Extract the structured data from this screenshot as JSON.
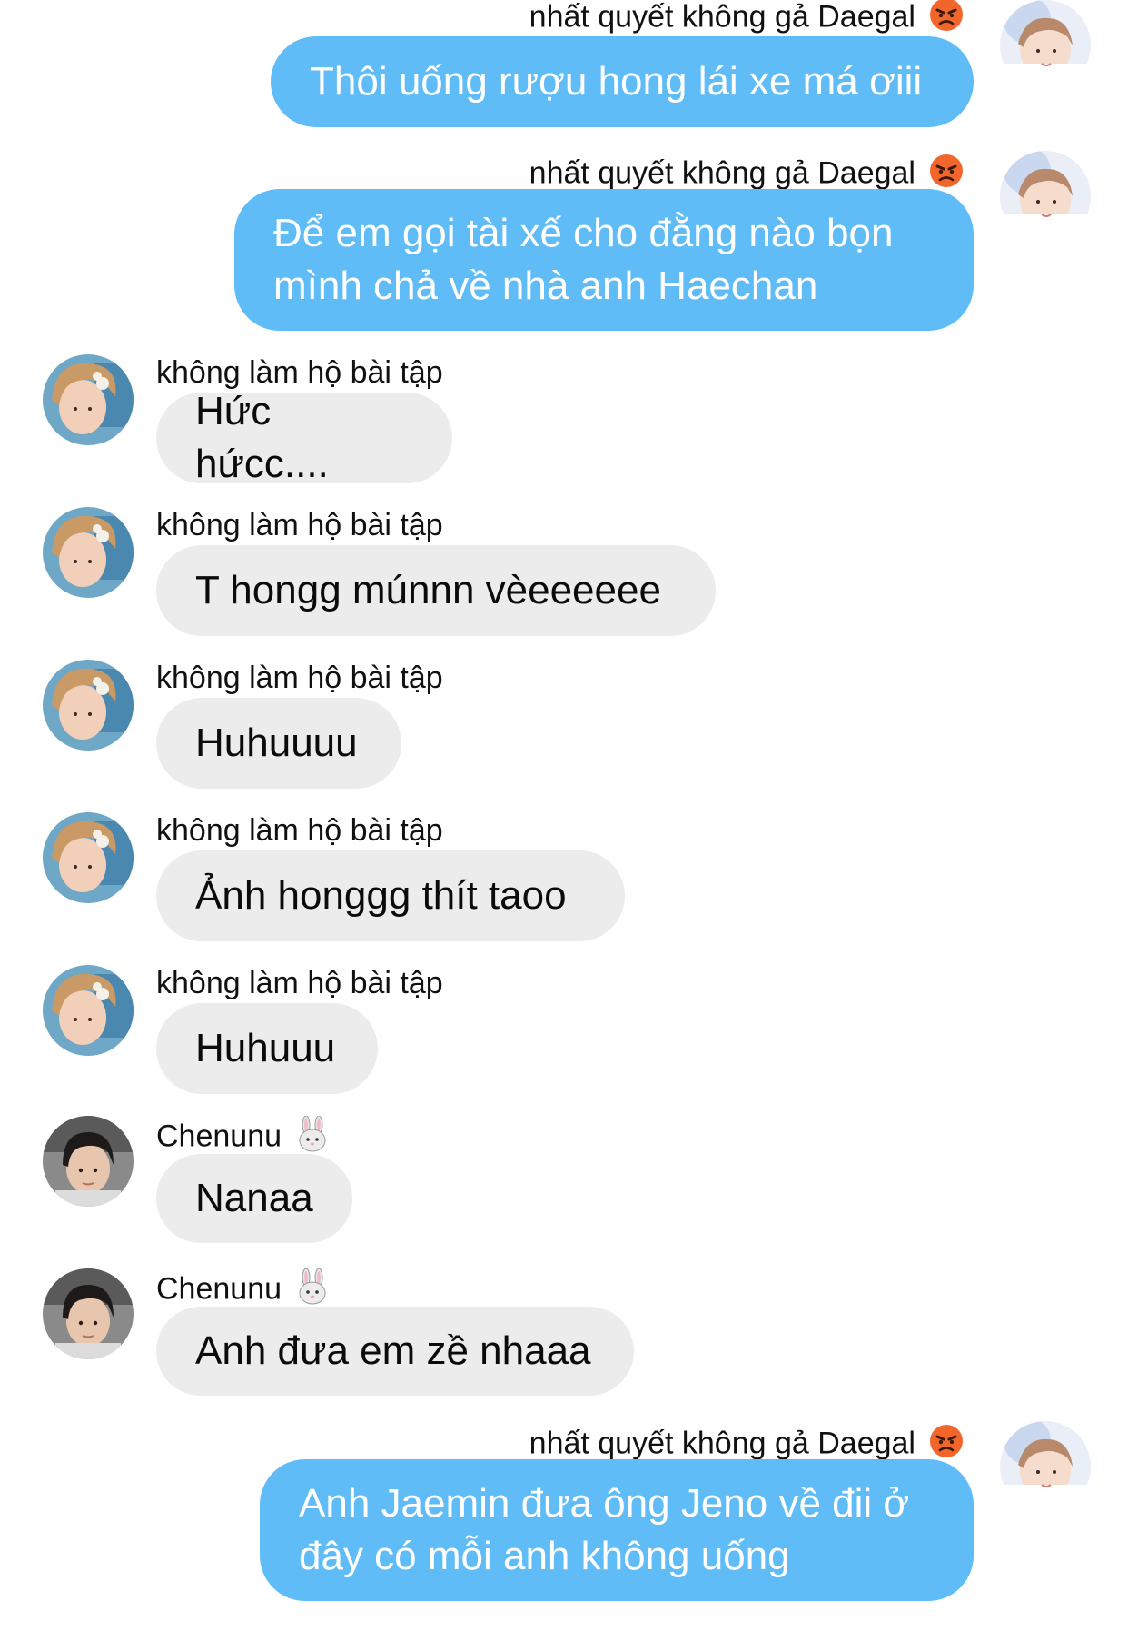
{
  "messages": [
    {
      "side": "out",
      "sender": "nhất quyết không gả Daegal",
      "text": "Thôi uống rượu hong lái xe má ơiii",
      "emoji": "angry-face-icon"
    },
    {
      "side": "out",
      "sender": "nhất quyết không gả Daegal",
      "text": "Để em gọi tài xế cho đằng nào bọn mình chả về nhà anh Haechan",
      "emoji": "angry-face-icon"
    },
    {
      "side": "in",
      "sender": "không làm hộ bài tập",
      "text": "Hức hứcc....",
      "emoji": ""
    },
    {
      "side": "in",
      "sender": "không làm hộ bài tập",
      "text": "T hongg múnnn vèeeeeee",
      "emoji": ""
    },
    {
      "side": "in",
      "sender": "không làm hộ bài tập",
      "text": "Huhuuuu",
      "emoji": ""
    },
    {
      "side": "in",
      "sender": "không làm hộ bài tập",
      "text": "Ảnh honggg thít taoo",
      "emoji": ""
    },
    {
      "side": "in",
      "sender": "không làm hộ bài tập",
      "text": "Huhuuu",
      "emoji": ""
    },
    {
      "side": "in",
      "sender": "Chenunu",
      "text": "Nanaa",
      "emoji": "rabbit-face-icon"
    },
    {
      "side": "in",
      "sender": "Chenunu",
      "text": "Anh đưa em zề nhaaa",
      "emoji": "rabbit-face-icon"
    },
    {
      "side": "out",
      "sender": "nhất quyết không gả Daegal",
      "text": "Anh Jaemin đưa ông Jeno về đii ở đây có mỗi anh không uống",
      "emoji": "angry-face-icon"
    }
  ],
  "colors": {
    "outgoing_bubble": "#5fbcf7",
    "incoming_bubble": "#ececec",
    "outgoing_text": "#ffffff",
    "incoming_text": "#0b0b0b"
  }
}
